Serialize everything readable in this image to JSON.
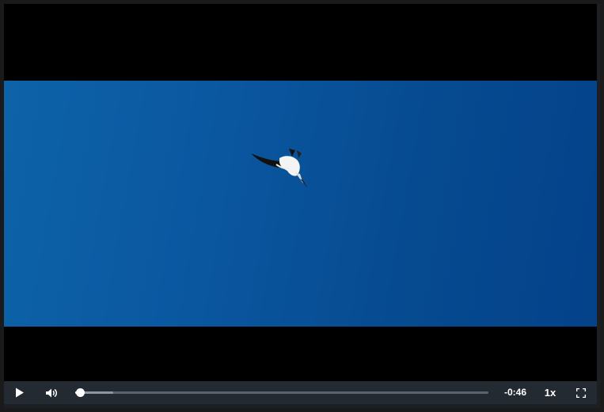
{
  "player": {
    "controls": {
      "play_icon": "play-icon",
      "volume_icon": "volume-icon",
      "time_remaining": "-0:46",
      "speed": "1x",
      "fullscreen_icon": "fullscreen-icon",
      "progress": {
        "played_fraction": 0.012,
        "buffered_fraction": 0.092
      }
    }
  },
  "colors": {
    "sky": "#0a57a0",
    "control_bar": "#232a31"
  }
}
